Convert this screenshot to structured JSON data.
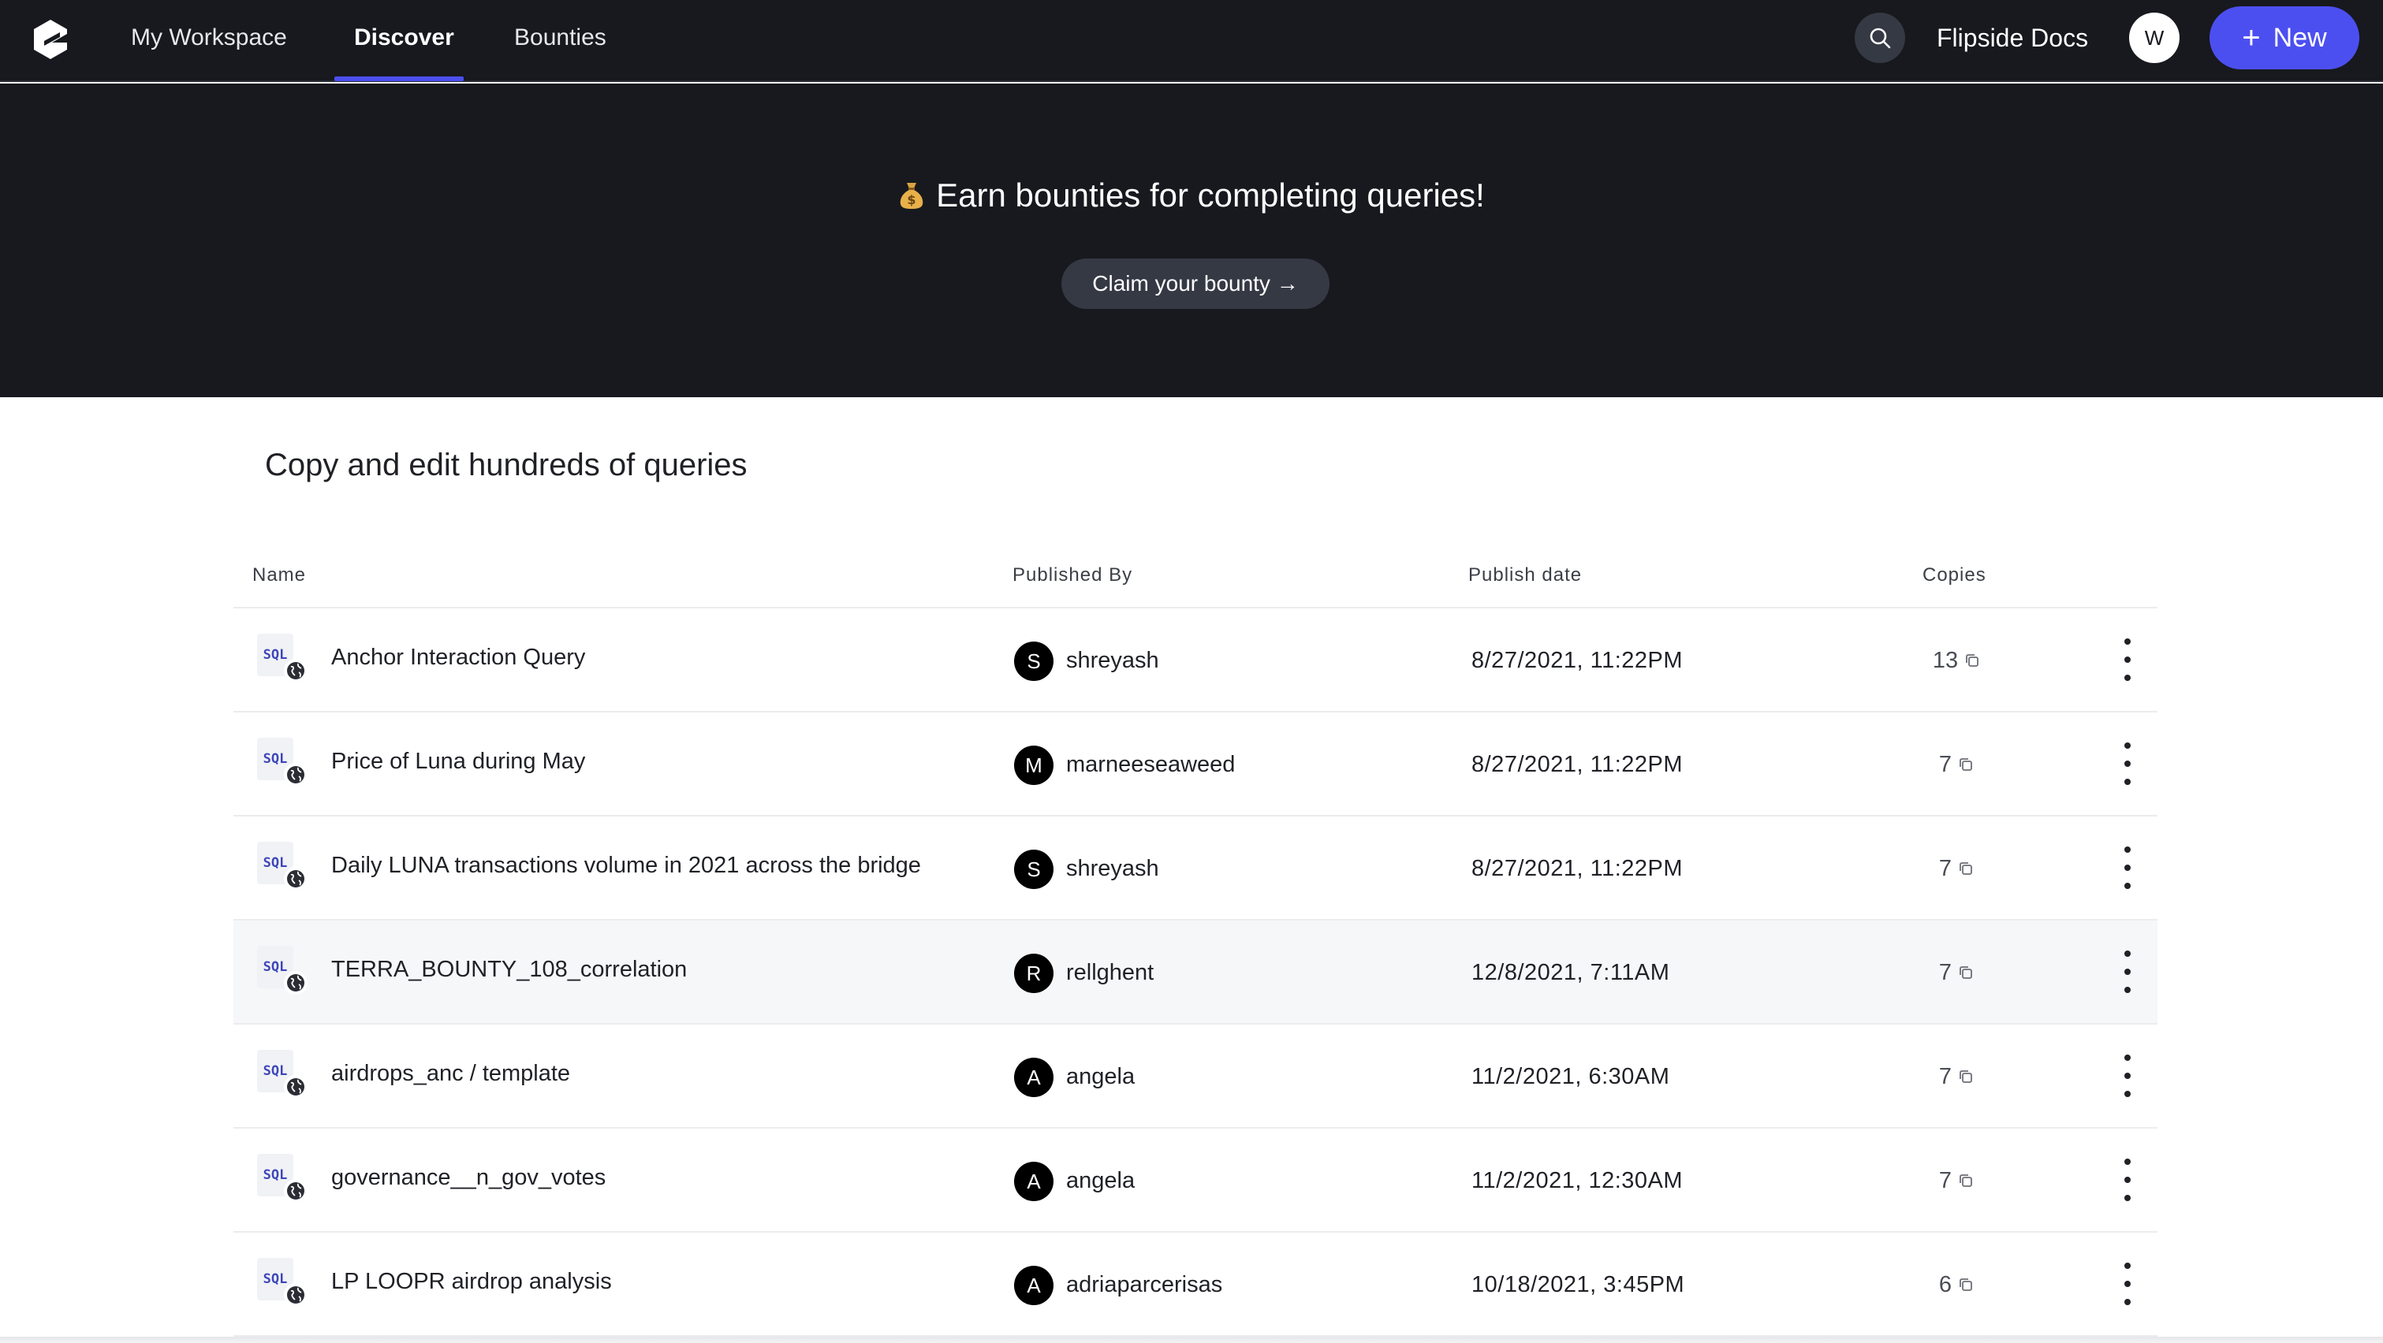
{
  "nav": {
    "tabs": [
      {
        "label": "My Workspace"
      },
      {
        "label": "Discover"
      },
      {
        "label": "Bounties"
      }
    ],
    "docs_label": "Flipside Docs",
    "avatar_initial": "W",
    "new_label": "New",
    "accent_color": "#4c4ff0"
  },
  "hero": {
    "title": "Earn bounties for completing queries!",
    "claim_label": "Claim your bounty →"
  },
  "main": {
    "title": "Copy and edit hundreds of queries",
    "columns": [
      "Name",
      "Published By",
      "Publish date",
      "Copies"
    ],
    "rows": [
      {
        "name": "Anchor Interaction Query",
        "initial": "S",
        "publisher": "shreyash",
        "date": "8/27/2021, 11:22PM",
        "copies": "13"
      },
      {
        "name": "Price of Luna during May",
        "initial": "M",
        "publisher": "marneeseaweed",
        "date": "8/27/2021, 11:22PM",
        "copies": "7"
      },
      {
        "name": "Daily LUNA transactions volume in 2021 across the bridge",
        "initial": "S",
        "publisher": "shreyash",
        "date": "8/27/2021, 11:22PM",
        "copies": "7"
      },
      {
        "name": "TERRA_BOUNTY_108_correlation",
        "initial": "R",
        "publisher": "rellghent",
        "date": "12/8/2021, 7:11AM",
        "copies": "7"
      },
      {
        "name": "airdrops_anc / template",
        "initial": "A",
        "publisher": "angela",
        "date": "11/2/2021, 6:30AM",
        "copies": "7"
      },
      {
        "name": "governance__n_gov_votes",
        "initial": "A",
        "publisher": "angela",
        "date": "11/2/2021, 12:30AM",
        "copies": "7"
      },
      {
        "name": "LP LOOPR airdrop analysis",
        "initial": "A",
        "publisher": "adriaparcerisas",
        "date": "10/18/2021, 3:45PM",
        "copies": "6"
      }
    ],
    "sql_badge": "SQL"
  }
}
